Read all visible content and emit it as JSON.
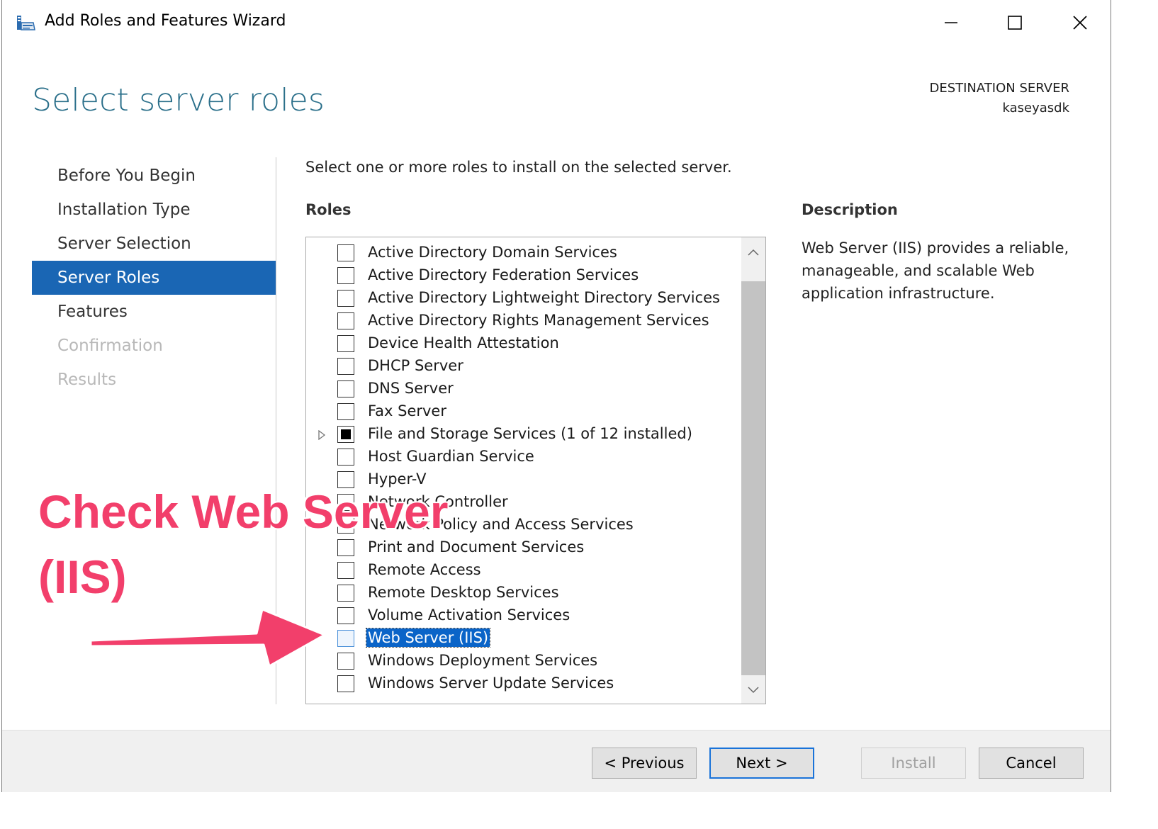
{
  "window": {
    "title": "Add Roles and Features Wizard",
    "icons": {
      "app": "server-manager-icon",
      "minimize": "minimize-icon",
      "maximize": "maximize-icon",
      "close": "close-icon"
    }
  },
  "header": {
    "page_title": "Select server roles",
    "destination_label": "DESTINATION SERVER",
    "destination_value": "kaseyasdk"
  },
  "nav": {
    "items": [
      {
        "label": "Before You Begin",
        "state": "normal"
      },
      {
        "label": "Installation Type",
        "state": "normal"
      },
      {
        "label": "Server Selection",
        "state": "normal"
      },
      {
        "label": "Server Roles",
        "state": "active"
      },
      {
        "label": "Features",
        "state": "normal"
      },
      {
        "label": "Confirmation",
        "state": "disabled"
      },
      {
        "label": "Results",
        "state": "disabled"
      }
    ]
  },
  "main": {
    "instructions": "Select one or more roles to install on the selected server.",
    "roles_heading": "Roles",
    "roles": [
      {
        "label": "Active Directory Domain Services",
        "checked": false
      },
      {
        "label": "Active Directory Federation Services",
        "checked": false
      },
      {
        "label": "Active Directory Lightweight Directory Services",
        "checked": false
      },
      {
        "label": "Active Directory Rights Management Services",
        "checked": false
      },
      {
        "label": "Device Health Attestation",
        "checked": false
      },
      {
        "label": "DHCP Server",
        "checked": false
      },
      {
        "label": "DNS Server",
        "checked": false
      },
      {
        "label": "Fax Server",
        "checked": false
      },
      {
        "label": "File and Storage Services (1 of 12 installed)",
        "checked": "partial",
        "expandable": true
      },
      {
        "label": "Host Guardian Service",
        "checked": false
      },
      {
        "label": "Hyper-V",
        "checked": false
      },
      {
        "label": "Network Controller",
        "checked": false
      },
      {
        "label": "Network Policy and Access Services",
        "checked": false
      },
      {
        "label": "Print and Document Services",
        "checked": false
      },
      {
        "label": "Remote Access",
        "checked": false
      },
      {
        "label": "Remote Desktop Services",
        "checked": false
      },
      {
        "label": "Volume Activation Services",
        "checked": false
      },
      {
        "label": "Web Server (IIS)",
        "checked": false,
        "selected": true
      },
      {
        "label": "Windows Deployment Services",
        "checked": false
      },
      {
        "label": "Windows Server Update Services",
        "checked": false
      }
    ],
    "description_heading": "Description",
    "description_text": "Web Server (IIS) provides a reliable, manageable, and scalable Web application infrastructure."
  },
  "footer": {
    "previous": "< Previous",
    "next": "Next >",
    "install": "Install",
    "cancel": "Cancel"
  },
  "annotation": {
    "line1": "Check Web Server",
    "line2": "(IIS)",
    "color": "#f23f6b"
  }
}
